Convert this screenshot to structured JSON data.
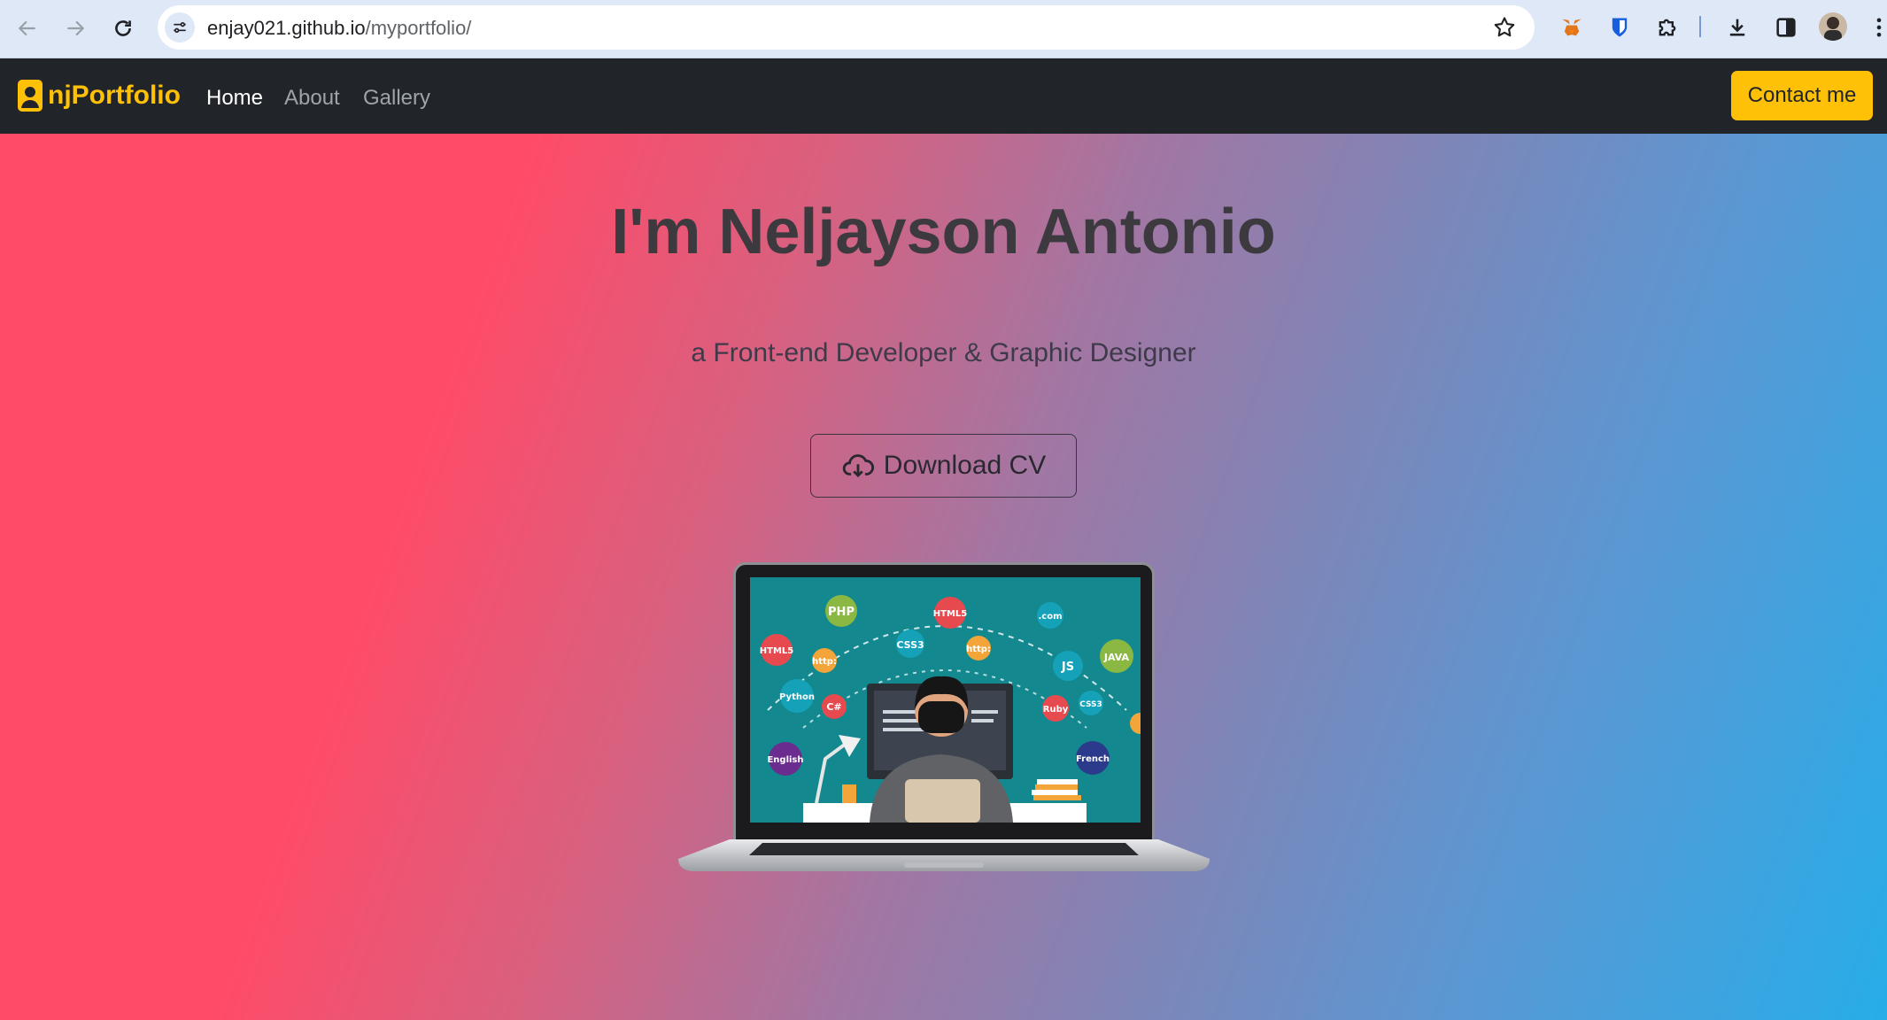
{
  "browser": {
    "url_host": "enjay021.github.io",
    "url_path": "/myportfolio/"
  },
  "navbar": {
    "brand": "njPortfolio",
    "links": [
      "Home",
      "About",
      "Gallery"
    ],
    "contact_label": "Contact me"
  },
  "hero": {
    "title": "I'm Neljayson Antonio",
    "subtitle": "a Front-end Developer & Graphic Designer",
    "cv_label": "Download CV"
  },
  "illustration": {
    "bubbles": [
      "PHP",
      "HTML5",
      "CSS3",
      "http:",
      "http:",
      ".com",
      "JS",
      "JAVA",
      "HTML5",
      "Python",
      "C#",
      "Ruby",
      "CSS3",
      "English",
      "French"
    ]
  },
  "colors": {
    "brand": "#ffc107",
    "navbar_bg": "#212529",
    "gradient_left": "#ff4b68",
    "gradient_right": "#27ade8"
  }
}
